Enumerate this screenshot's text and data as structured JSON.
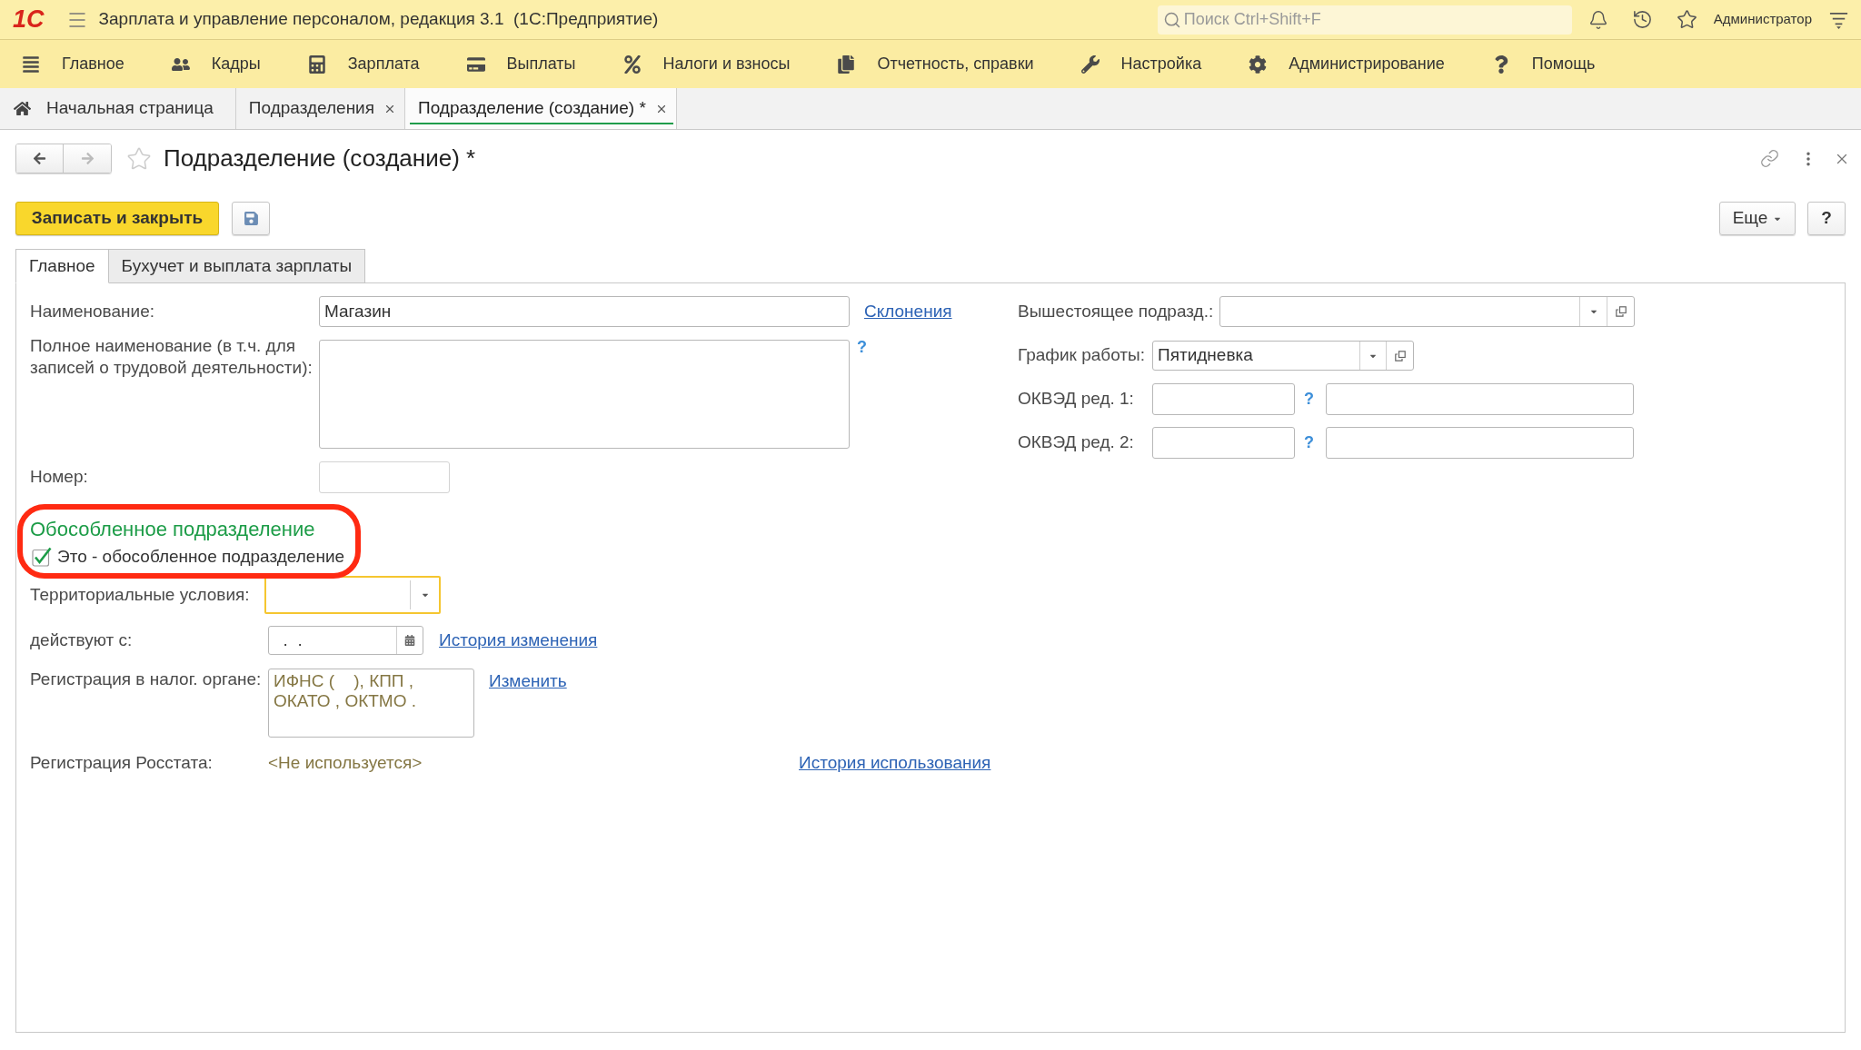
{
  "app_bar": {
    "logo": "1С",
    "title": "Зарплата и управление персоналом, редакция 3.1  (1С:Предприятие)",
    "search": {
      "placeholder": "Поиск Ctrl+Shift+F"
    },
    "user": "Администратор"
  },
  "main_menu": [
    "Главное",
    "Кадры",
    "Зарплата",
    "Выплаты",
    "Налоги и взносы",
    "Отчетность, справки",
    "Настройка",
    "Администрирование",
    "Помощь"
  ],
  "open_tabs": [
    {
      "kind": "home",
      "label": "Начальная страница",
      "selected": false
    },
    {
      "kind": "page",
      "label": "Подразделения",
      "selected": false
    },
    {
      "kind": "page",
      "label": "Подразделение (создание) *",
      "selected": true
    }
  ],
  "form": {
    "navigation": {
      "back_enabled": true,
      "forward_enabled": false
    },
    "favorite": false,
    "title": "Подразделение (создание) *",
    "toolbar": {
      "save_and_close": "Записать и закрыть",
      "more": "Еще",
      "help": "?"
    },
    "tabs": [
      {
        "label": "Главное",
        "selected": true
      },
      {
        "label": "Бухучет и выплата зарплаты",
        "selected": false
      }
    ],
    "name": {
      "label": "Наименование:",
      "value": "Магазин",
      "link": "Склонения"
    },
    "full_name": {
      "label": "Полное наименование (в т.ч. для\nзаписей о трудовой деятельности):",
      "help": "?"
    },
    "number": {
      "label": "Номер:"
    },
    "separate_division": {
      "highlighted": true,
      "heading": "Обособленное подразделение",
      "checkbox": {
        "label": "Это - обособленное подразделение",
        "checked": true
      }
    },
    "territorial_conditions": {
      "label": "Территориальные условия:",
      "focused": true
    },
    "effective_from": {
      "label": "действуют с:",
      "value": "  .  .",
      "link": "История изменения"
    },
    "tax_registration": {
      "label": "Регистрация в налог. органе:",
      "value": "ИФНС (    ), КПП ,\nОКАТО , ОКТМО .",
      "link": "Изменить"
    },
    "rosstat_registration": {
      "label": "Регистрация Росстата:",
      "value": "<Не используется>",
      "link": "История использования"
    },
    "parent_unit": {
      "label": "Вышестоящее подразд.:"
    },
    "work_schedule": {
      "label": "График работы:",
      "value": "Пятидневка"
    },
    "okved": [
      {
        "label": "ОКВЭД ред. 1:",
        "help": "?"
      },
      {
        "label": "ОКВЭД ред. 2:",
        "help": "?"
      }
    ]
  }
}
